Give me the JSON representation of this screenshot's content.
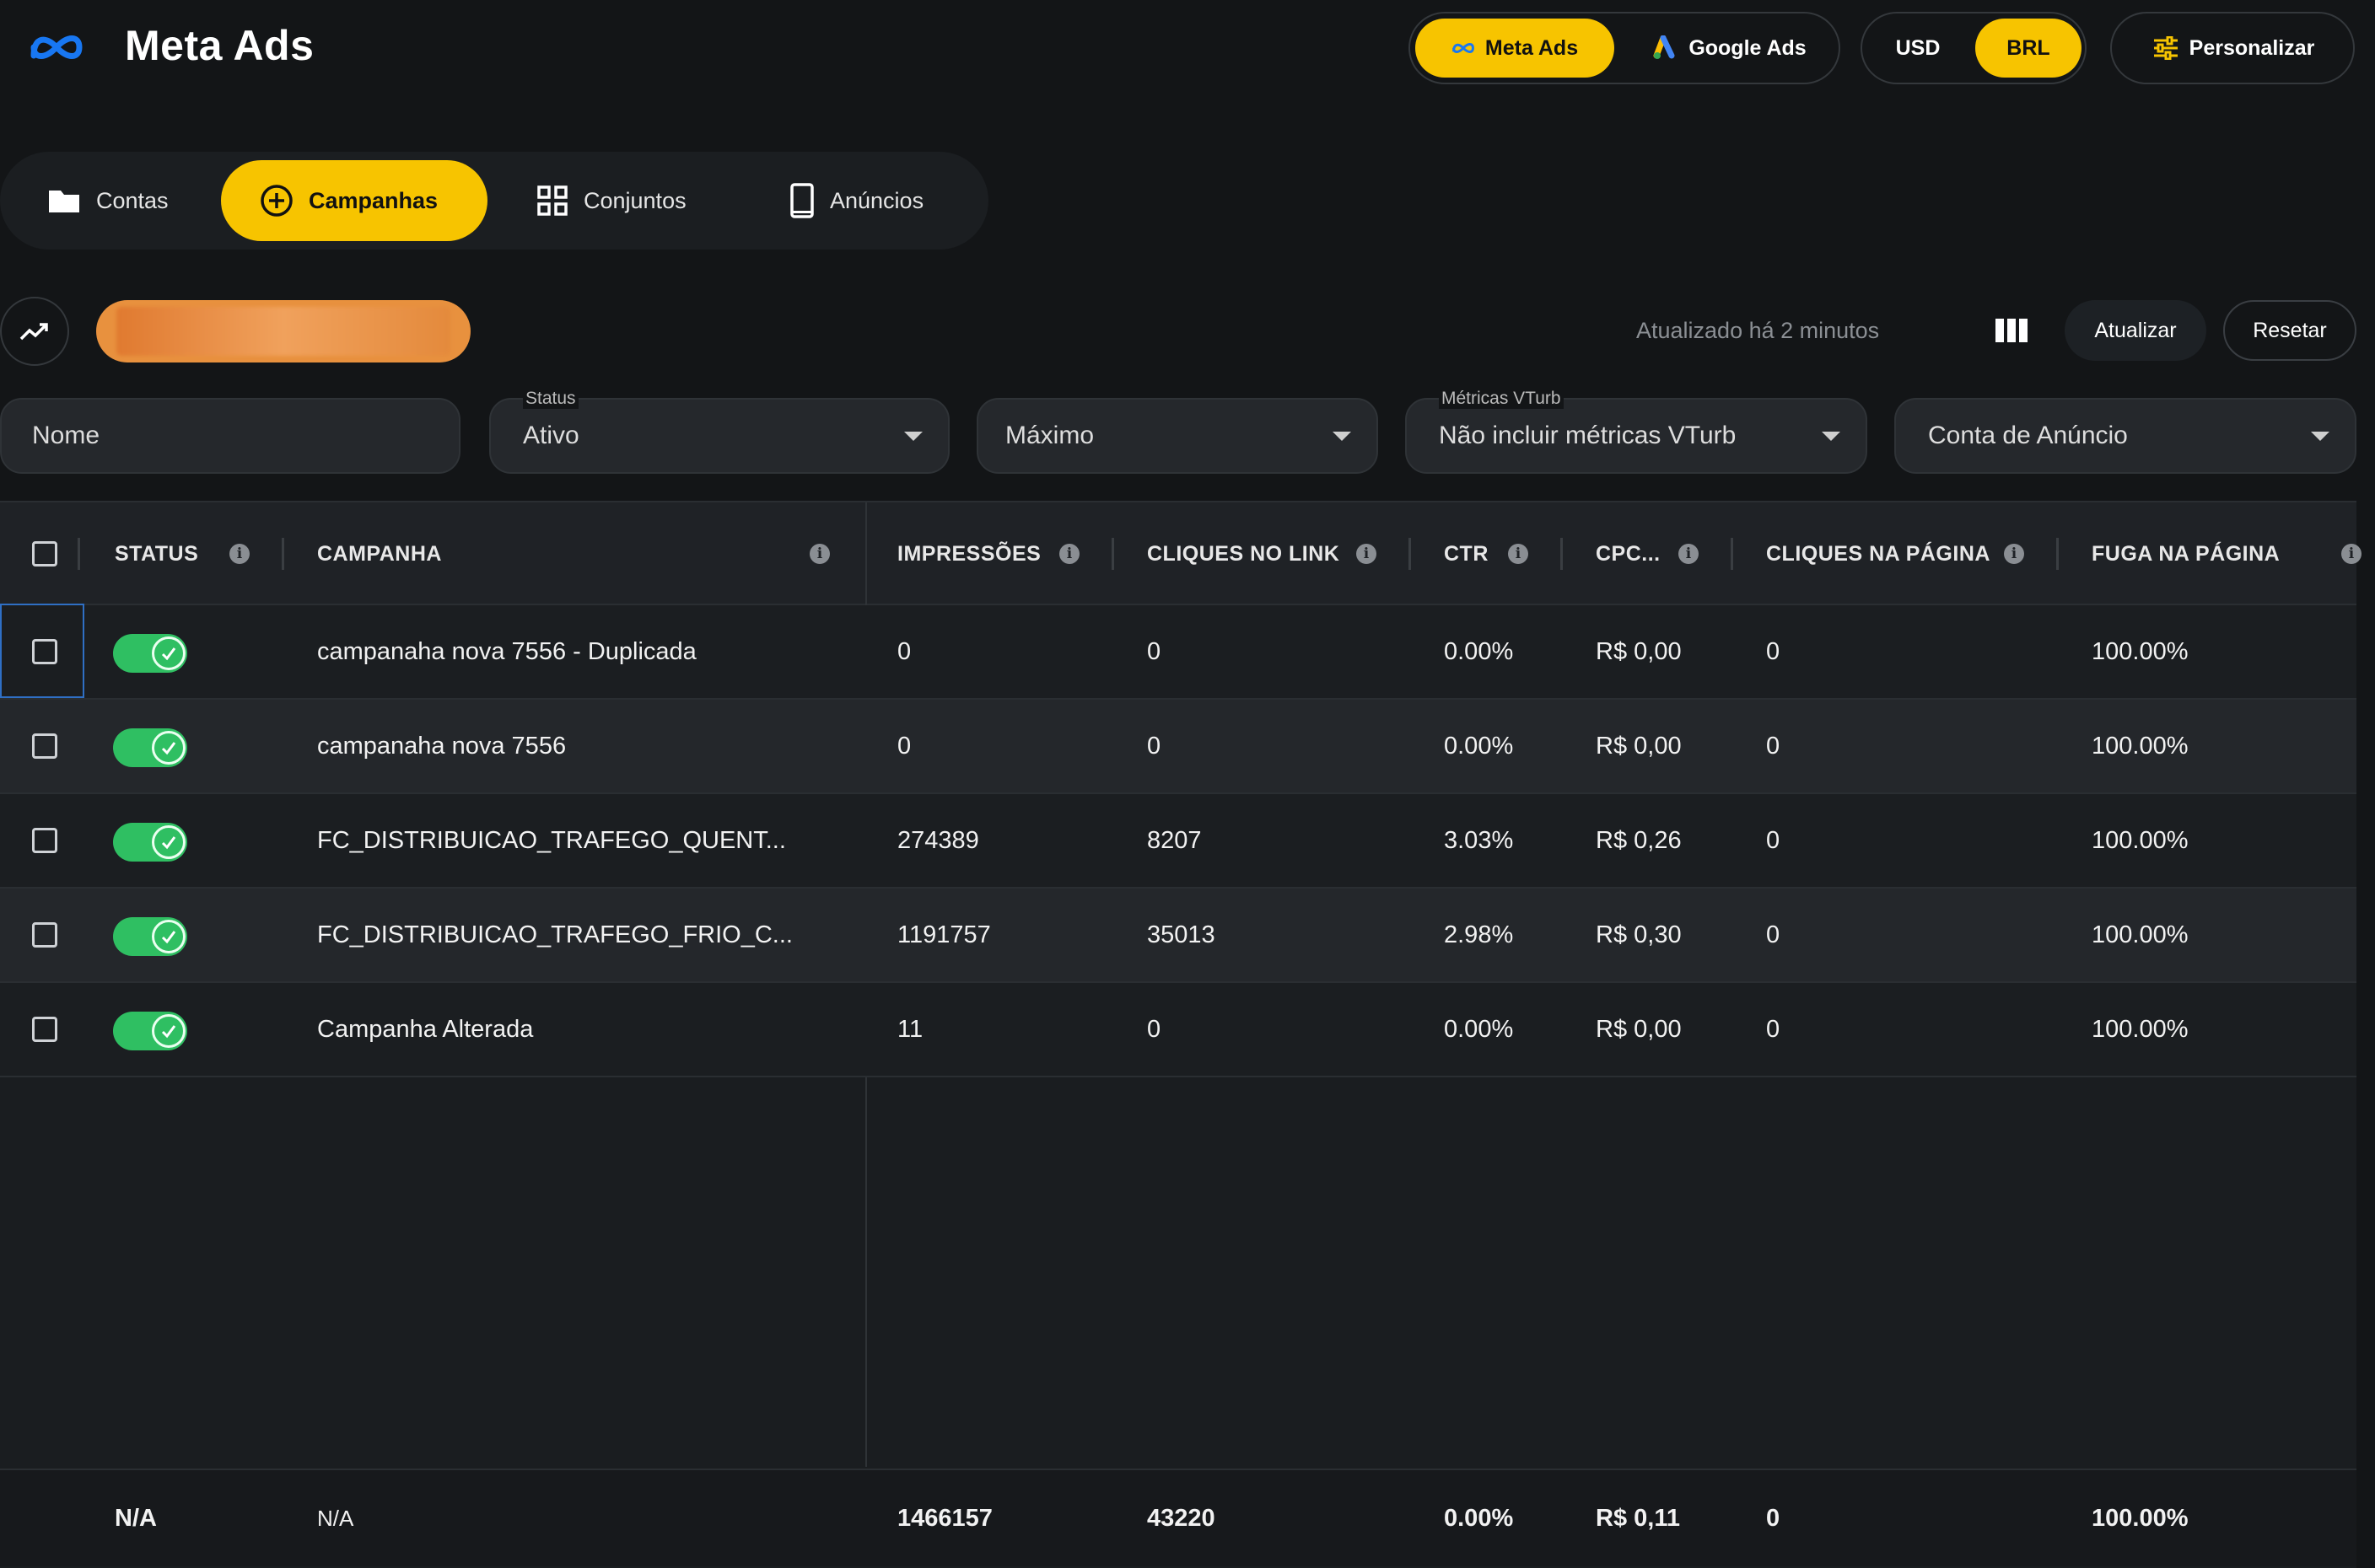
{
  "header": {
    "title": "Meta Ads",
    "platforms": [
      {
        "label": "Meta Ads",
        "active": true
      },
      {
        "label": "Google Ads",
        "active": false
      }
    ],
    "currencies": [
      {
        "label": "USD",
        "active": false
      },
      {
        "label": "BRL",
        "active": true
      }
    ],
    "customize_label": "Personalizar"
  },
  "tabs": [
    {
      "label": "Contas",
      "icon": "folder-icon",
      "active": false
    },
    {
      "label": "Campanhas",
      "icon": "plus-circle-icon",
      "active": true
    },
    {
      "label": "Conjuntos",
      "icon": "grid-icon",
      "active": false
    },
    {
      "label": "Anúncios",
      "icon": "phone-icon",
      "active": false
    }
  ],
  "toolbar": {
    "updated_text": "Atualizado há 2 minutos",
    "update_label": "Atualizar",
    "reset_label": "Resetar"
  },
  "filters": {
    "name": {
      "placeholder": "Nome"
    },
    "status": {
      "label": "Status",
      "value": "Ativo"
    },
    "period": {
      "value": "Máximo"
    },
    "vturb": {
      "label": "Métricas VTurb",
      "value": "Não incluir métricas VTurb"
    },
    "account": {
      "value": "Conta de Anúncio"
    }
  },
  "table": {
    "headers": [
      "STATUS",
      "CAMPANHA",
      "IMPRESSÕES",
      "CLIQUES NO LINK",
      "CTR",
      "CPC...",
      "CLIQUES NA PÁGINA",
      "FUGA NA PÁGINA"
    ],
    "rows": [
      {
        "name": "campanaha nova 7556 - Duplicada",
        "impressions": "0",
        "clicks": "0",
        "ctr": "0.00%",
        "cpc": "R$ 0,00",
        "page_clicks": "0",
        "bounce": "100.00%",
        "status_on": true
      },
      {
        "name": "campanaha nova 7556",
        "impressions": "0",
        "clicks": "0",
        "ctr": "0.00%",
        "cpc": "R$ 0,00",
        "page_clicks": "0",
        "bounce": "100.00%",
        "status_on": true
      },
      {
        "name": "FC_DISTRIBUICAO_TRAFEGO_QUENT...",
        "impressions": "274389",
        "clicks": "8207",
        "ctr": "3.03%",
        "cpc": "R$ 0,26",
        "page_clicks": "0",
        "bounce": "100.00%",
        "status_on": true
      },
      {
        "name": "FC_DISTRIBUICAO_TRAFEGO_FRIO_C...",
        "impressions": "1191757",
        "clicks": "35013",
        "ctr": "2.98%",
        "cpc": "R$ 0,30",
        "page_clicks": "0",
        "bounce": "100.00%",
        "status_on": true
      },
      {
        "name": "Campanha Alterada",
        "impressions": "11",
        "clicks": "0",
        "ctr": "0.00%",
        "cpc": "R$ 0,00",
        "page_clicks": "0",
        "bounce": "100.00%",
        "status_on": true
      }
    ],
    "footer": {
      "status": "N/A",
      "name": "N/A",
      "impressions": "1466157",
      "clicks": "43220",
      "ctr": "0.00%",
      "cpc": "R$ 0,11",
      "page_clicks": "0",
      "bounce": "100.00%"
    }
  },
  "colors": {
    "accent": "#f7c400",
    "background": "#131517",
    "toggle_on": "#2fbf62",
    "account_chip": "#e8913e"
  }
}
